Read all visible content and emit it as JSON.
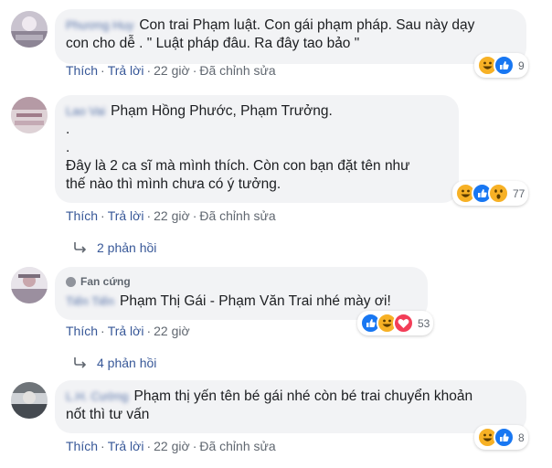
{
  "comments": [
    {
      "author": "Phương Huy",
      "lines": [
        "Con trai Phạm luật. Con gái phạm pháp. Sau này dạy",
        "con cho dễ . \" Luật pháp đâu. Ra đây tao bảo \""
      ],
      "reaction_count": "9",
      "reactions": [
        "haha-icon",
        "like-icon"
      ],
      "actions": {
        "like": "Thích",
        "reply": "Trả lời",
        "time": "22 giờ",
        "edited": "Đã chỉnh sửa",
        "sep": "·"
      }
    },
    {
      "author": "Lao Vai",
      "lines": [
        "Phạm Hồng Phước, Phạm Trưởng.",
        ".",
        ".",
        "Đây là 2 ca sĩ mà mình thích. Còn con bạn đặt tên như",
        "thế nào thì mình chưa có ý tưởng."
      ],
      "reaction_count": "77",
      "reactions": [
        "haha-icon",
        "like-icon",
        "wow-icon"
      ],
      "actions": {
        "like": "Thích",
        "reply": "Trả lời",
        "time": "22 giờ",
        "edited": "Đã chỉnh sửa",
        "sep": "·"
      },
      "replies_label": "2 phản hồi"
    },
    {
      "badge": "Fan cứng",
      "author": "Tiến Tiến",
      "lines": [
        "Phạm Thị Gái - Phạm Văn Trai nhé mày ơi!"
      ],
      "reaction_count": "53",
      "reactions": [
        "like-icon",
        "haha-icon",
        "love-icon"
      ],
      "actions": {
        "like": "Thích",
        "reply": "Trả lời",
        "time": "22 giờ",
        "sep": "·"
      },
      "replies_label": "4 phản hồi"
    },
    {
      "author": "L.H. Cường",
      "lines": [
        "Phạm thị yến tên bé gái nhé còn bé trai chuyển khoản",
        "nốt thì tư vấn"
      ],
      "reaction_count": "8",
      "reactions": [
        "haha-icon",
        "like-icon"
      ],
      "actions": {
        "like": "Thích",
        "reply": "Trả lời",
        "time": "22 giờ",
        "edited": "Đã chỉnh sửa",
        "sep": "·"
      }
    }
  ],
  "colors": {
    "link": "#385898",
    "meta": "#606770",
    "bubble": "#f2f3f5",
    "like": "#1877f2",
    "haha": "#f7b125",
    "love": "#f33e58"
  }
}
